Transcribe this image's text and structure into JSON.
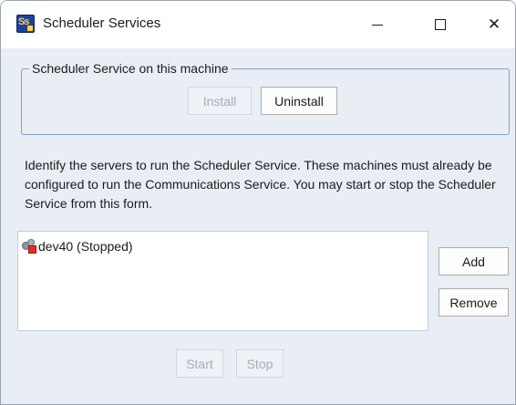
{
  "window": {
    "title": "Scheduler Services",
    "app_icon": "scheduler-app-icon",
    "app_icon_text": "Ss"
  },
  "titlebar_buttons": {
    "minimize_icon": "minimize-icon",
    "maximize_icon": "maximize-icon",
    "close_icon": "close-icon",
    "close_glyph": "✕"
  },
  "service_group": {
    "label": "Scheduler Service on this machine",
    "install_label": "Install",
    "install_enabled": false,
    "uninstall_label": "Uninstall",
    "uninstall_enabled": true
  },
  "description": "Identify the servers to run the Scheduler Service. These machines must already be configured to run the Communications Service. You may start or stop the Scheduler Service from this form.",
  "servers": {
    "items": [
      {
        "label": "dev40 (Stopped)",
        "icon": "server-stopped-icon"
      }
    ]
  },
  "server_buttons": {
    "add_label": "Add",
    "remove_label": "Remove",
    "start_label": "Start",
    "start_enabled": false,
    "stop_label": "Stop",
    "stop_enabled": false
  },
  "colors": {
    "client_background": "#e9eef5",
    "group_border": "#7fa2c9",
    "stopped_status": "#e0321e"
  }
}
